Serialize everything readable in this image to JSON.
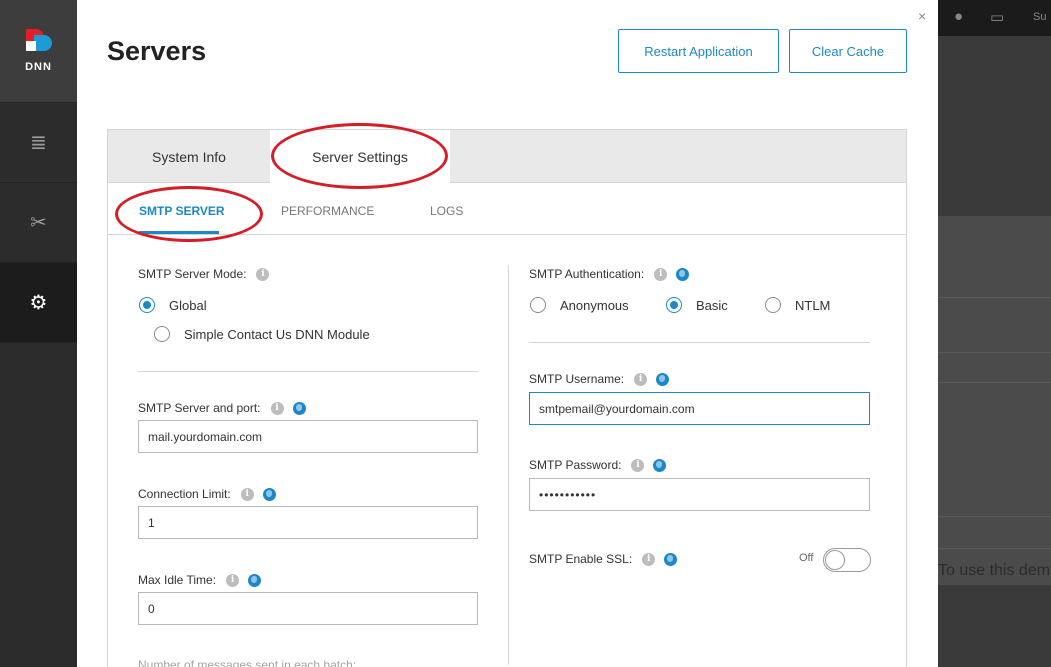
{
  "nav": {
    "logo_text": "DNN",
    "items": [
      {
        "icon": "content-icon",
        "glyph": "≣"
      },
      {
        "icon": "tools-icon",
        "glyph": "✂"
      },
      {
        "icon": "gear-icon",
        "glyph": "⚙"
      }
    ]
  },
  "background": {
    "top_label": "Su",
    "body_text": "To use this dem"
  },
  "page": {
    "title": "Servers",
    "restart_label": "Restart Application",
    "clear_cache_label": "Clear Cache",
    "close_glyph": "×"
  },
  "tabs": {
    "system_info": "System Info",
    "server_settings": "Server Settings"
  },
  "subtabs": {
    "smtp": "SMTP SERVER",
    "performance": "PERFORMANCE",
    "logs": "LOGS"
  },
  "left": {
    "mode_label": "SMTP Server Mode:",
    "mode_global": "Global",
    "mode_simple": "Simple Contact Us DNN Module",
    "server_port_label": "SMTP Server and port:",
    "server_port_value": "mail.yourdomain.com",
    "connection_limit_label": "Connection Limit:",
    "connection_limit_value": "1",
    "max_idle_label": "Max Idle Time:",
    "max_idle_value": "0",
    "cut_label": "Number of messages sent in each batch:"
  },
  "right": {
    "auth_label": "SMTP Authentication:",
    "auth_anonymous": "Anonymous",
    "auth_basic": "Basic",
    "auth_ntlm": "NTLM",
    "username_label": "SMTP Username:",
    "username_value": "smtpemail@yourdomain.com",
    "password_label": "SMTP Password:",
    "password_value": "•••••••••••",
    "ssl_label": "SMTP Enable SSL:",
    "ssl_state": "Off"
  },
  "colors": {
    "accent": "#1e88c7",
    "annotation": "#d71c25"
  }
}
